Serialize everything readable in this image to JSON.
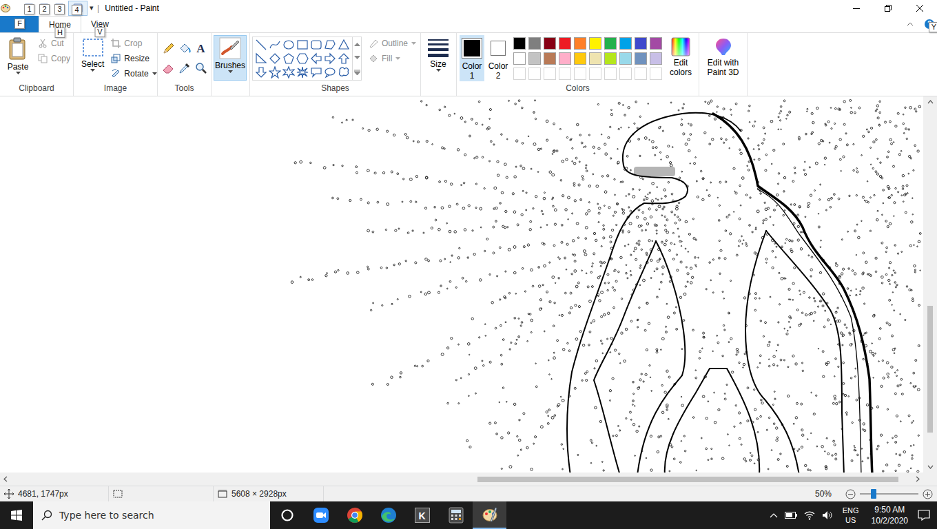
{
  "window": {
    "title": "Untitled - Paint",
    "separator": "|",
    "customize": "▾"
  },
  "quick_access": [
    {
      "keytip": "1"
    },
    {
      "keytip": "2"
    },
    {
      "keytip": "3"
    },
    {
      "keytip": "4"
    }
  ],
  "file_tab": {
    "keytip": "F"
  },
  "tabs": [
    {
      "label": "Home",
      "keytip": "H",
      "selected": true
    },
    {
      "label": "View",
      "keytip": "V",
      "selected": false
    }
  ],
  "help": {
    "icon": "?",
    "keytip": "Y"
  },
  "ribbon": {
    "clipboard": {
      "label": "Clipboard",
      "paste": "Paste",
      "cut": {
        "label": "Cut",
        "disabled": true
      },
      "copy": {
        "label": "Copy",
        "disabled": true
      }
    },
    "image": {
      "label": "Image",
      "select": "Select",
      "crop": {
        "label": "Crop",
        "disabled": true
      },
      "resize": {
        "label": "Resize",
        "disabled": false
      },
      "rotate": {
        "label": "Rotate",
        "disabled": false
      }
    },
    "tools": {
      "label": "Tools",
      "text_tool": "A"
    },
    "brushes": {
      "label": "Brushes",
      "selected": true
    },
    "shapes": {
      "label": "Shapes",
      "outline": {
        "label": "Outline",
        "disabled": true
      },
      "fill": {
        "label": "Fill",
        "disabled": true
      }
    },
    "size": {
      "label": "Size"
    },
    "colors": {
      "label": "Colors",
      "color1": {
        "label": "Color 1",
        "color": "#000000",
        "selected": true
      },
      "color2": {
        "label": "Color 2",
        "color": "#ffffff",
        "selected": false
      },
      "palette": [
        {
          "color": "#000000",
          "empty": false
        },
        {
          "color": "#7f7f7f",
          "empty": false
        },
        {
          "color": "#880015",
          "empty": false
        },
        {
          "color": "#ed1c24",
          "empty": false
        },
        {
          "color": "#ff7f27",
          "empty": false
        },
        {
          "color": "#fff200",
          "empty": false
        },
        {
          "color": "#22b14c",
          "empty": false
        },
        {
          "color": "#00a2e8",
          "empty": false
        },
        {
          "color": "#3f48cc",
          "empty": false
        },
        {
          "color": "#a349a4",
          "empty": false
        },
        {
          "color": "#ffffff",
          "empty": false
        },
        {
          "color": "#c3c3c3",
          "empty": false
        },
        {
          "color": "#b97a57",
          "empty": false
        },
        {
          "color": "#ffaec9",
          "empty": false
        },
        {
          "color": "#ffc90e",
          "empty": false
        },
        {
          "color": "#efe4b0",
          "empty": false
        },
        {
          "color": "#b5e61d",
          "empty": false
        },
        {
          "color": "#99d9ea",
          "empty": false
        },
        {
          "color": "#7092be",
          "empty": false
        },
        {
          "color": "#c8bfe7",
          "empty": false
        },
        {
          "color": "#ffffff",
          "empty": true
        },
        {
          "color": "#ffffff",
          "empty": true
        },
        {
          "color": "#ffffff",
          "empty": true
        },
        {
          "color": "#ffffff",
          "empty": true
        },
        {
          "color": "#ffffff",
          "empty": true
        },
        {
          "color": "#ffffff",
          "empty": true
        },
        {
          "color": "#ffffff",
          "empty": true
        },
        {
          "color": "#ffffff",
          "empty": true
        },
        {
          "color": "#ffffff",
          "empty": true
        },
        {
          "color": "#ffffff",
          "empty": true
        }
      ],
      "edit_colors": "Edit colors"
    },
    "paint3d": "Edit with Paint 3D"
  },
  "scrollbars": {
    "vertical": {
      "level": 0.36,
      "offset": 0.56
    },
    "horizontal": {
      "level": 0.47,
      "offset": 0.52
    }
  },
  "status_bar": {
    "cursor": "4681, 1747px",
    "canvas_size": "5608 × 2928px",
    "zoom": "50%",
    "zoom_level": 0.24
  },
  "taskbar": {
    "search_placeholder": "Type here to search",
    "apps": [
      {
        "kind": "cortana",
        "label": "",
        "selected": false
      },
      {
        "kind": "zoom",
        "label": "",
        "selected": false
      },
      {
        "kind": "chrome",
        "label": "",
        "selected": false
      },
      {
        "kind": "edge",
        "label": "",
        "selected": false
      },
      {
        "kind": "kapp",
        "label": "K",
        "selected": false
      },
      {
        "kind": "calculator",
        "label": "",
        "selected": false
      },
      {
        "kind": "paint",
        "label": "",
        "selected": true
      }
    ],
    "tray": {
      "language": "ENG",
      "region": "US",
      "time": "9:50 AM",
      "date": "10/2/2020"
    }
  }
}
